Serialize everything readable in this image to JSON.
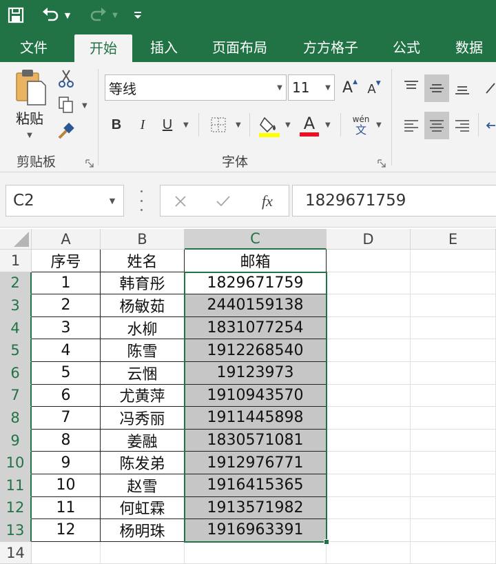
{
  "ribbon_tabs": [
    "文件",
    "开始",
    "插入",
    "页面布局",
    "方方格子",
    "公式",
    "数据"
  ],
  "ribbon": {
    "paste_label": "粘贴",
    "clipboard_group_label": "剪贴板",
    "font_group_label": "字体",
    "font_name": "等线",
    "font_size": "11",
    "bold": "B",
    "italic": "I",
    "underline": "U",
    "phonetic_top": "wén",
    "phonetic_bottom": "文",
    "increase_font": "A",
    "decrease_font": "A",
    "font_color_letter": "A"
  },
  "colors": {
    "excel_green": "#217346",
    "highlight_yellow": "#ffff00",
    "font_red": "#e81123",
    "selection_fill": "#c6c6c6"
  },
  "formula_bar": {
    "name_box": "C2",
    "fx": "fx",
    "value": "1829671759"
  },
  "columns": [
    "A",
    "B",
    "C",
    "D",
    "E"
  ],
  "rows": [
    "1",
    "2",
    "3",
    "4",
    "5",
    "6",
    "7",
    "8",
    "9",
    "10",
    "11",
    "12",
    "13",
    "14"
  ],
  "table": {
    "headers": [
      "序号",
      "姓名",
      "邮箱"
    ],
    "rows": [
      [
        "1",
        "韩育彤",
        "1829671759"
      ],
      [
        "2",
        "杨敏茹",
        "2440159138"
      ],
      [
        "3",
        "水柳",
        "1831077254"
      ],
      [
        "4",
        "陈雪",
        "1912268540"
      ],
      [
        "5",
        "云悃",
        "19123973"
      ],
      [
        "6",
        "尤黄萍",
        "1910943570"
      ],
      [
        "7",
        "冯秀丽",
        "1911445898"
      ],
      [
        "8",
        "姜融",
        "1830571081"
      ],
      [
        "9",
        "陈发弟",
        "1912976771"
      ],
      [
        "10",
        "赵雪",
        "1916415365"
      ],
      [
        "11",
        "何虹霖",
        "1913571982"
      ],
      [
        "12",
        "杨明珠",
        "1916963391"
      ]
    ]
  },
  "selection": "C2:C13",
  "active_cell": "C2"
}
